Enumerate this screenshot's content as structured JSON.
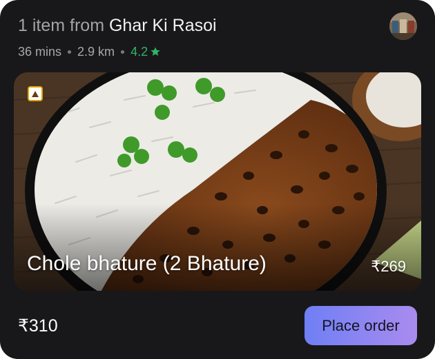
{
  "header": {
    "prefix": "1 item from ",
    "restaurant": "Ghar Ki Rasoi",
    "eta": "36 mins",
    "distance": "2.9 km",
    "rating": "4.2",
    "rating_icon": "star-icon",
    "rating_color": "#2fb56a"
  },
  "item": {
    "name": "Chole bhature (2 Bhature)",
    "price": "₹269",
    "diet_badge_icon": "non-veg-triangle-icon",
    "diet_badge_color": "#e0a300"
  },
  "footer": {
    "total": "₹310",
    "cta_label": "Place order",
    "cta_gradient": [
      "#6f7ff5",
      "#a98bef"
    ]
  },
  "colors": {
    "card_background": "#18181a"
  }
}
